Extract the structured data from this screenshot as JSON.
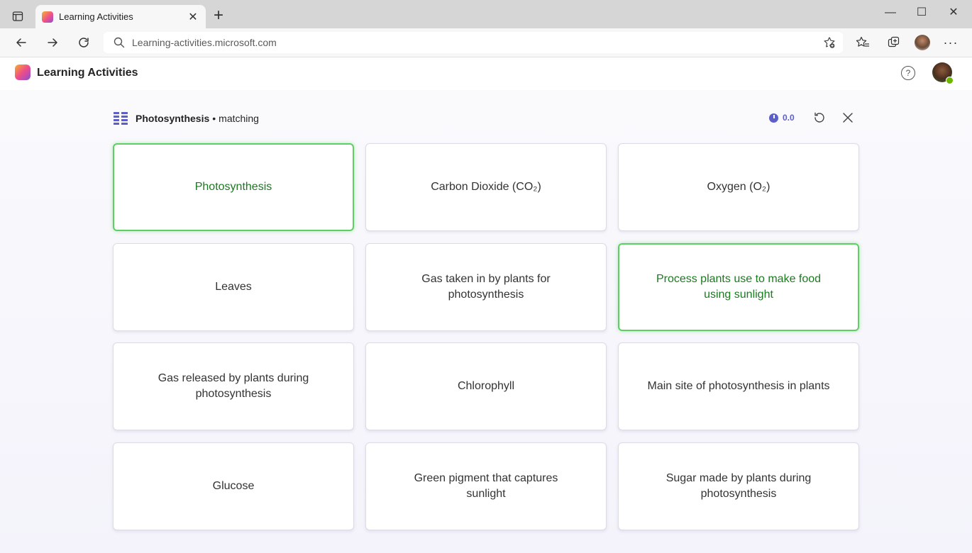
{
  "browser": {
    "tab_title": "Learning Activities",
    "tab_close": "✕",
    "new_tab": "+",
    "url": "Learning-activities.microsoft.com",
    "minimize": "—",
    "maximize": "☐",
    "close": "✕"
  },
  "app": {
    "title": "Learning Activities",
    "help": "?"
  },
  "activity": {
    "topic": "Photosynthesis",
    "separator": "•",
    "mode": "matching",
    "timer": "0.0"
  },
  "cards": [
    {
      "text": "Photosynthesis",
      "state": "selected"
    },
    {
      "text": "Carbon Dioxide (CO₂)",
      "state": "default"
    },
    {
      "text": "Oxygen (O₂)",
      "state": "default"
    },
    {
      "text": "Leaves",
      "state": "default"
    },
    {
      "text": "Gas taken in by plants for photosynthesis",
      "state": "default"
    },
    {
      "text": "Process plants use to make food using sunlight",
      "state": "selected"
    },
    {
      "text": "Gas released by plants during photosynthesis",
      "state": "default"
    },
    {
      "text": "Chlorophyll",
      "state": "default"
    },
    {
      "text": "Main site of photosynthesis in plants",
      "state": "default"
    },
    {
      "text": "Glucose",
      "state": "default"
    },
    {
      "text": "Green pigment that captures sunlight",
      "state": "default"
    },
    {
      "text": "Sugar made by plants during photosynthesis",
      "state": "default"
    }
  ],
  "colors": {
    "accent": "#5b5fc7",
    "selected_border": "#5ecf62",
    "selected_text": "#1b7a1f"
  }
}
